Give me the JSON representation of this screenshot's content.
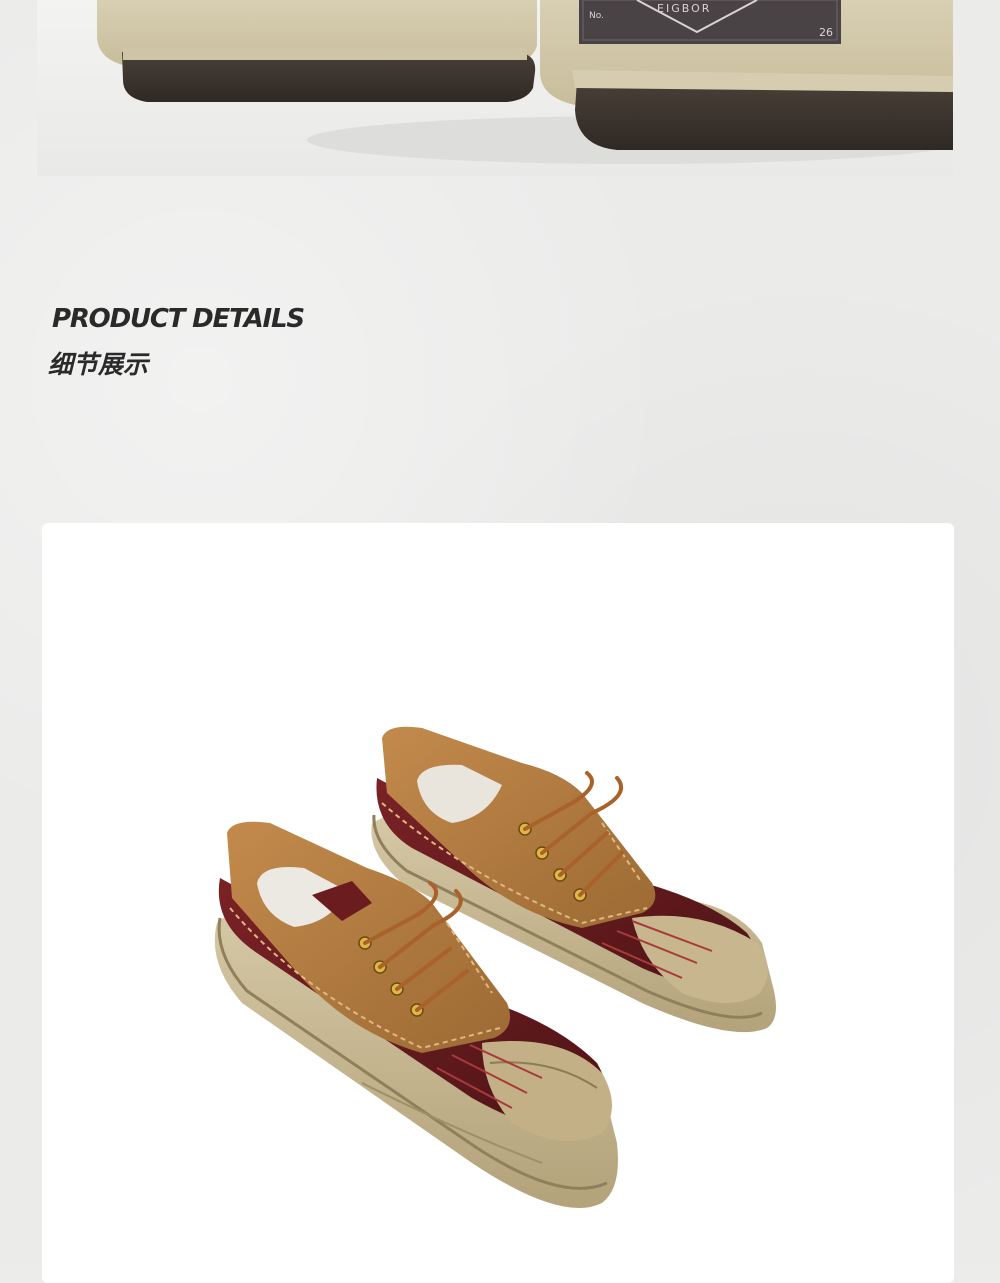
{
  "heading": {
    "title_en": "PRODUCT DETAILS",
    "title_cn": "细节展示"
  },
  "top_photo": {
    "label_text": "EIGBOR",
    "label_no": "No.",
    "label_number": "26"
  },
  "colors": {
    "background": "#ebebea",
    "suede": "#b07a3f",
    "leather": "#6a1c1f",
    "sole": "#c9b994",
    "heading_text": "#2a2a2a"
  }
}
